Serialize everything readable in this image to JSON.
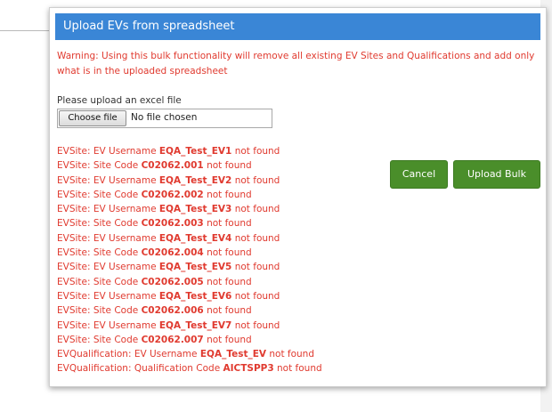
{
  "modal": {
    "title": "Upload EVs from spreadsheet",
    "warning": "Warning: Using this bulk functionality will remove all existing EV Sites and Qualifications and add only what is in the uploaded spreadsheet",
    "upload_label": "Please upload an excel file",
    "choose_file_label": "Choose file",
    "file_status": "No file chosen",
    "cancel_label": "Cancel",
    "upload_bulk_label": "Upload Bulk"
  },
  "errors": [
    {
      "prefix": "EVSite: EV Username ",
      "value": "EQA_Test_EV1",
      "suffix": " not found"
    },
    {
      "prefix": "EVSite: Site Code ",
      "value": "C02062.001",
      "suffix": " not found"
    },
    {
      "prefix": "EVSite: EV Username ",
      "value": "EQA_Test_EV2",
      "suffix": " not found"
    },
    {
      "prefix": "EVSite: Site Code ",
      "value": "C02062.002",
      "suffix": " not found"
    },
    {
      "prefix": "EVSite: EV Username ",
      "value": "EQA_Test_EV3",
      "suffix": " not found"
    },
    {
      "prefix": "EVSite: Site Code ",
      "value": "C02062.003",
      "suffix": " not found"
    },
    {
      "prefix": "EVSite: EV Username ",
      "value": "EQA_Test_EV4",
      "suffix": " not found"
    },
    {
      "prefix": "EVSite: Site Code ",
      "value": "C02062.004",
      "suffix": " not found"
    },
    {
      "prefix": "EVSite: EV Username ",
      "value": "EQA_Test_EV5",
      "suffix": " not found"
    },
    {
      "prefix": "EVSite: Site Code ",
      "value": "C02062.005",
      "suffix": " not found"
    },
    {
      "prefix": "EVSite: EV Username ",
      "value": "EQA_Test_EV6",
      "suffix": " not found"
    },
    {
      "prefix": "EVSite: Site Code ",
      "value": "C02062.006",
      "suffix": " not found"
    },
    {
      "prefix": "EVSite: EV Username ",
      "value": "EQA_Test_EV7",
      "suffix": " not found"
    },
    {
      "prefix": "EVSite: Site Code ",
      "value": "C02062.007",
      "suffix": " not found"
    },
    {
      "prefix": "EVQualification: EV Username ",
      "value": "EQA_Test_EV",
      "suffix": " not found"
    },
    {
      "prefix": "EVQualification: Qualification Code ",
      "value": "AICTSPP3",
      "suffix": " not found"
    }
  ],
  "colors": {
    "header_bg": "#3a86d6",
    "error_text": "#e03a2f",
    "button_green": "#4a8e2a"
  }
}
